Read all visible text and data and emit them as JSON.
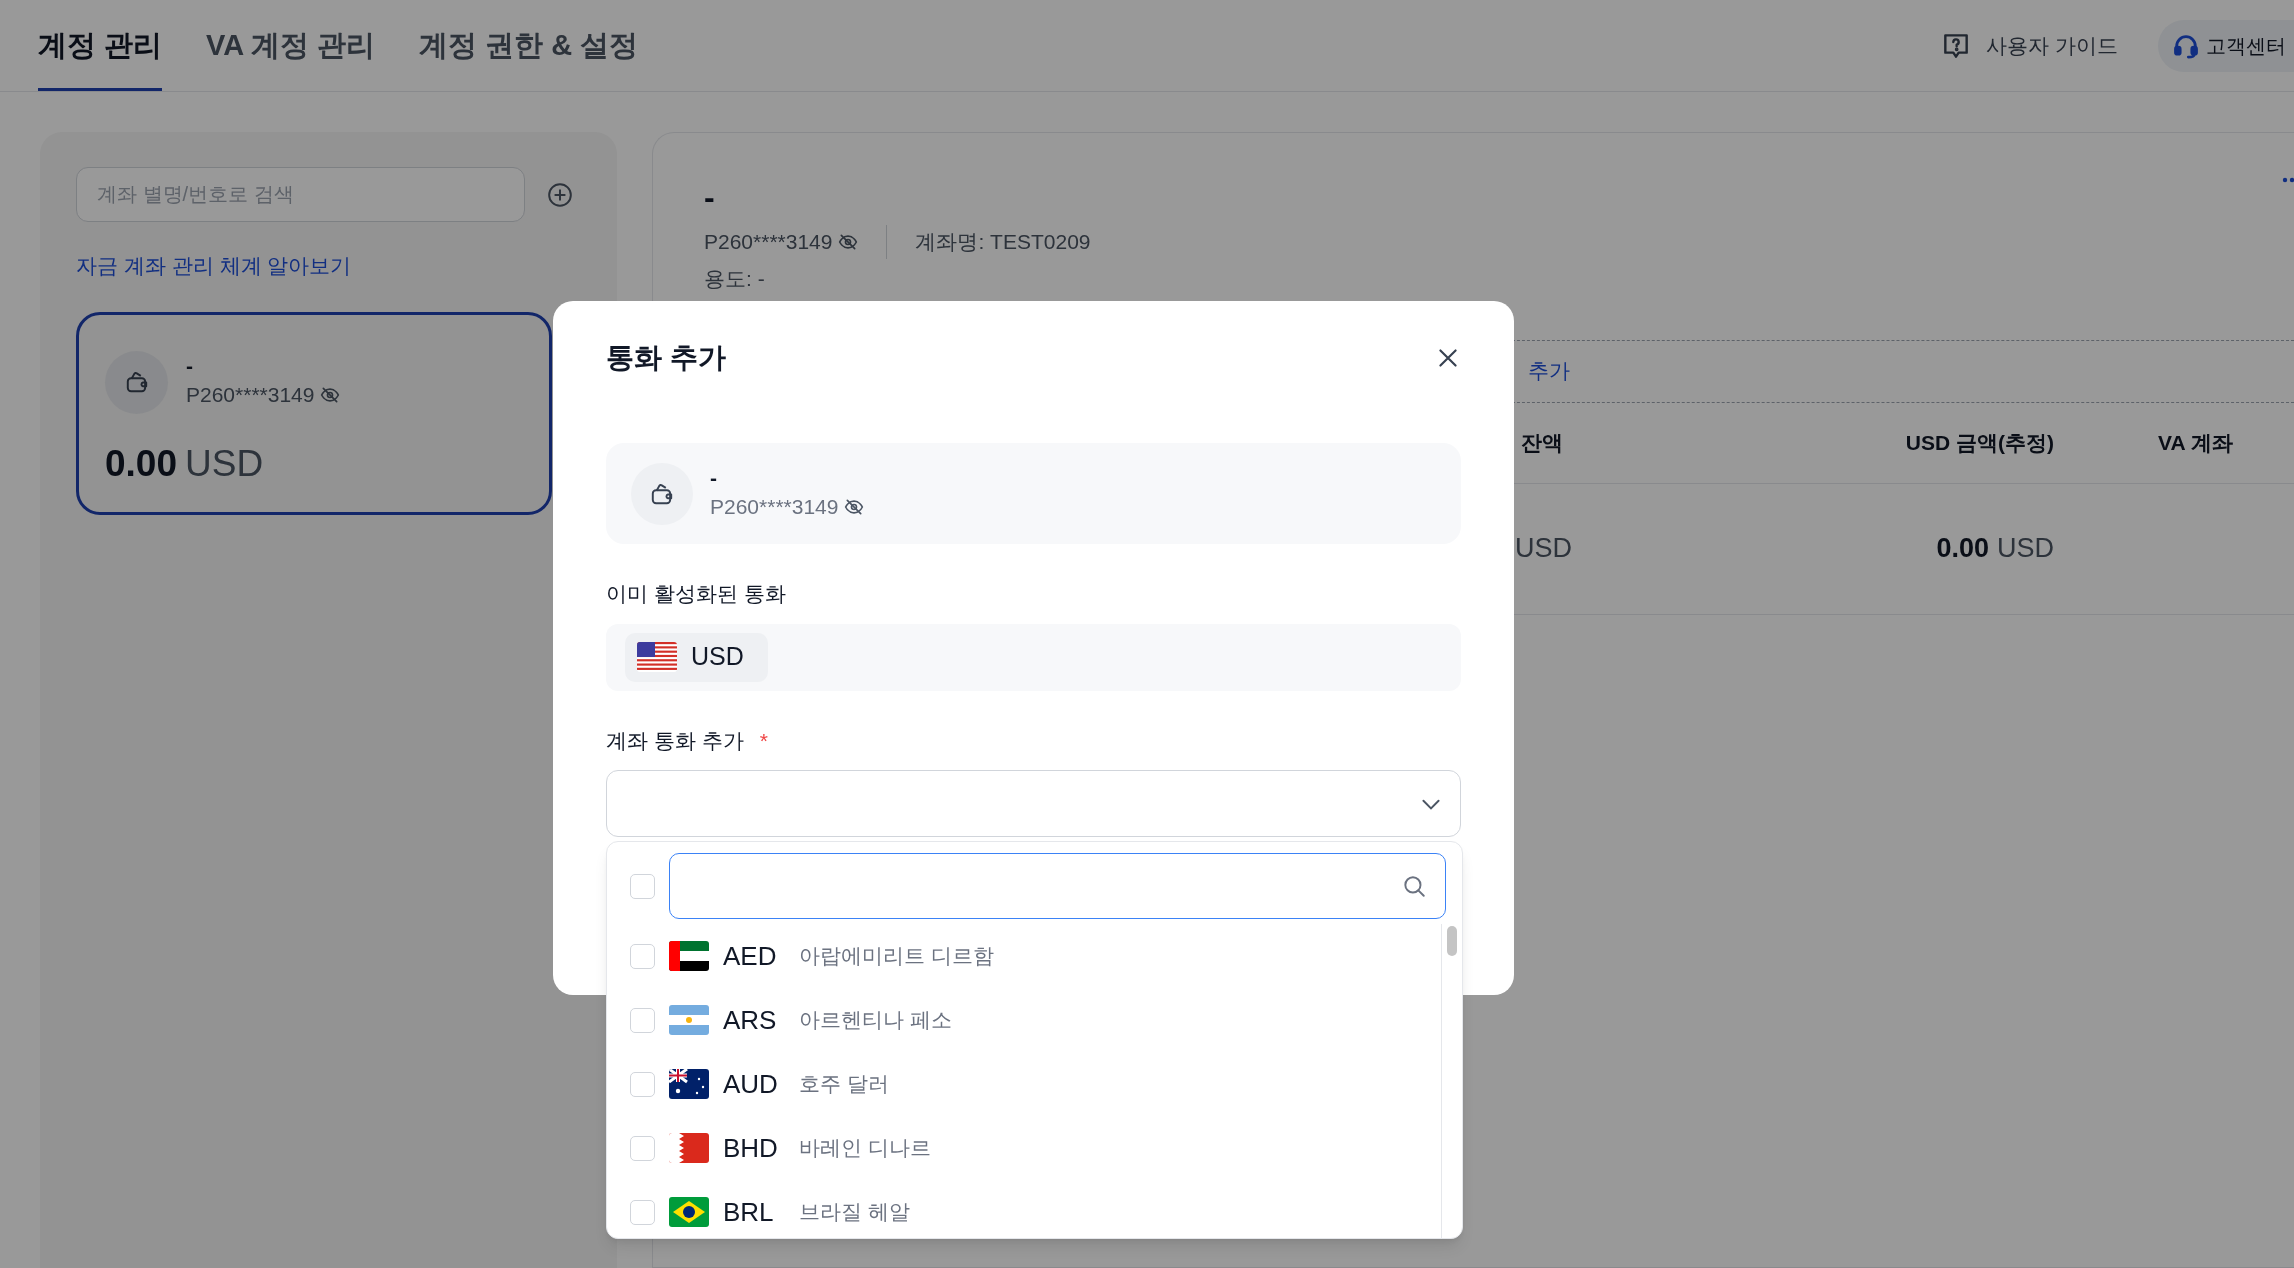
{
  "tabs": [
    {
      "label": "계정 관리",
      "selected": true
    },
    {
      "label": "VA 계정 관리",
      "selected": false
    },
    {
      "label": "계정 권한 & 설정",
      "selected": false
    }
  ],
  "header_actions": [
    {
      "label": "사용자 가이드",
      "kind": "guide"
    },
    {
      "label": "고객센터",
      "kind": "support"
    }
  ],
  "sidebar": {
    "search": {
      "placeholder": "계좌 별명/번호로 검색"
    },
    "link": "자금 계좌 관리 체계 알아보기",
    "accounts": [
      {
        "name": "-",
        "number": "P260****3149",
        "amount": "0.00",
        "currency": "USD",
        "selected": true
      }
    ]
  },
  "detail": {
    "name": "-",
    "number": "P260****3149",
    "account_name": "계좌명: TEST0209",
    "purpose": "용도: -",
    "action_link": "추가",
    "table": {
      "columns": [
        "잔액",
        "USD 금액(추정)",
        "VA 계좌"
      ],
      "rows": [
        {
          "balance_currency": "USD",
          "usd_amount": "0.00",
          "usd_currency": "USD"
        }
      ]
    }
  },
  "modal": {
    "title": "통화 추가",
    "account": {
      "name": "-",
      "number": "P260****3149"
    },
    "active_label": "이미 활성화된 통화",
    "active_currencies": [
      {
        "code": "USD",
        "kind": "us"
      }
    ],
    "add_label": "계좌 통화 추가",
    "required_mark": "*",
    "select": {
      "expanded": true
    },
    "dropdown": {
      "select_all_checked": false,
      "options": [
        {
          "code": "AED",
          "name": "아랍에미리트 디르함",
          "kind": "ae",
          "checked": false
        },
        {
          "code": "ARS",
          "name": "아르헨티나 페소",
          "kind": "ar",
          "checked": false
        },
        {
          "code": "AUD",
          "name": "호주 달러",
          "kind": "au",
          "checked": false
        },
        {
          "code": "BHD",
          "name": "바레인 디나르",
          "kind": "bh",
          "checked": false
        },
        {
          "code": "BRL",
          "name": "브라질 헤알",
          "kind": "br",
          "checked": false
        }
      ]
    }
  }
}
